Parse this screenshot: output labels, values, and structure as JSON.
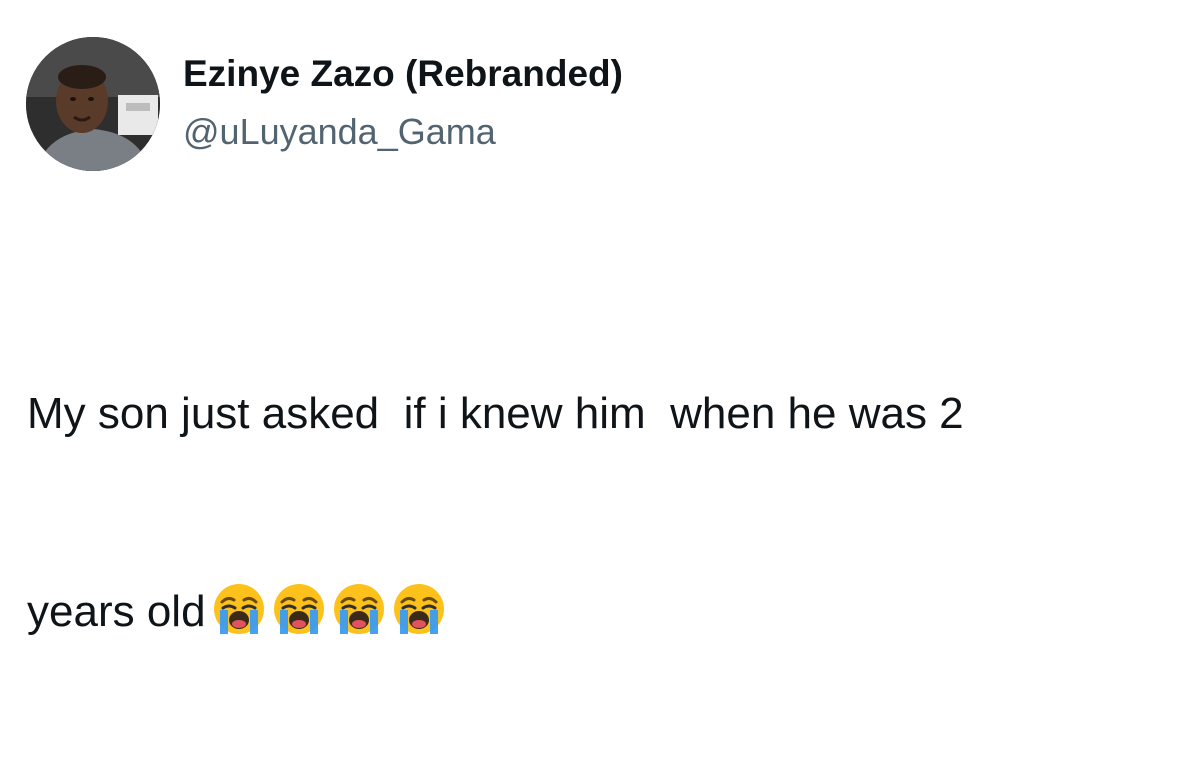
{
  "author": {
    "display_name": "Ezinye Zazo (Rebranded)",
    "handle": "@uLuyanda_Gama",
    "avatar_icon": "profile-photo"
  },
  "tweet": {
    "text_line_1": "My son just asked  if i knew him  when he was 2",
    "text_line_2": "years old",
    "emojis": [
      "loudly-crying-face",
      "loudly-crying-face",
      "loudly-crying-face",
      "loudly-crying-face"
    ]
  },
  "colors": {
    "name": "#0f1419",
    "handle": "#536471",
    "emoji_face": "#fcc21b",
    "emoji_tears": "#3b9cf0"
  }
}
